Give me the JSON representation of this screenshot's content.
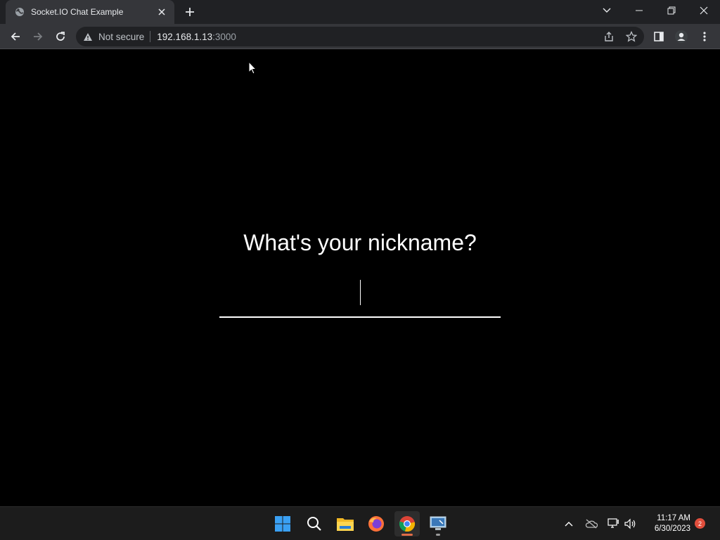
{
  "browser": {
    "tab": {
      "title": "Socket.IO Chat Example",
      "favicon": "globe-icon"
    },
    "new_tab_icon": "plus-icon",
    "window_controls": [
      "tab-search-icon",
      "minimize-icon",
      "restore-icon",
      "close-icon"
    ],
    "toolbar": {
      "security_label": "Not secure",
      "url_host": "192.168.1.13",
      "url_port": ":3000"
    }
  },
  "page": {
    "heading": "What's your nickname?",
    "nickname_value": ""
  },
  "taskbar": {
    "apps": [
      "start-icon",
      "search-icon",
      "file-explorer-icon",
      "firefox-icon",
      "chrome-icon",
      "remote-desktop-icon"
    ],
    "clock": {
      "time": "11:17 AM",
      "date": "6/30/2023"
    },
    "notification_count": "2"
  },
  "colors": {
    "page_background": "#000000",
    "chrome_dark": "#202124",
    "chrome_tab": "#35363a",
    "taskbar": "#1c1c1c",
    "badge": "#e04e3c"
  }
}
